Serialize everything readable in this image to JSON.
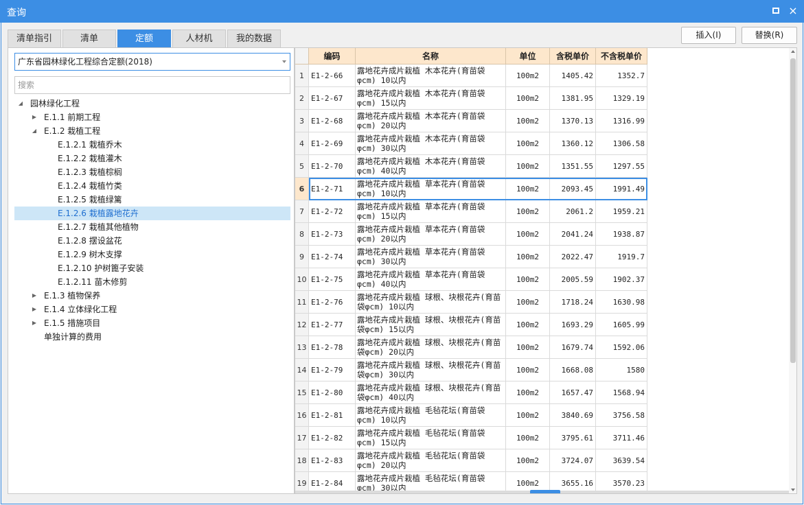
{
  "window": {
    "title": "查询",
    "maximize_icon": "maximize-icon",
    "close_glyph": "×"
  },
  "tabs": [
    {
      "label": "清单指引",
      "active": false
    },
    {
      "label": "清单",
      "active": false
    },
    {
      "label": "定额",
      "active": true
    },
    {
      "label": "人材机",
      "active": false
    },
    {
      "label": "我的数据",
      "active": false
    }
  ],
  "toolbar": {
    "insert_label": "插入(I)",
    "replace_label": "替换(R)"
  },
  "left": {
    "dropdown_value": "广东省园林绿化工程综合定额(2018)",
    "search_placeholder": "搜索",
    "tree": [
      {
        "label": "园林绿化工程",
        "level": 0,
        "toggle": "expanded"
      },
      {
        "label": "E.1.1 前期工程",
        "level": 1,
        "toggle": "collapsed"
      },
      {
        "label": "E.1.2 栽植工程",
        "level": 1,
        "toggle": "expanded"
      },
      {
        "label": "E.1.2.1 栽植乔木",
        "level": 2,
        "toggle": "none"
      },
      {
        "label": "E.1.2.2 栽植灌木",
        "level": 2,
        "toggle": "none"
      },
      {
        "label": "E.1.2.3 栽植棕榈",
        "level": 2,
        "toggle": "none"
      },
      {
        "label": "E.1.2.4 栽植竹类",
        "level": 2,
        "toggle": "none"
      },
      {
        "label": "E.1.2.5 栽植绿篱",
        "level": 2,
        "toggle": "none"
      },
      {
        "label": "E.1.2.6 栽植露地花卉",
        "level": 2,
        "toggle": "none",
        "selected": true
      },
      {
        "label": "E.1.2.7 栽植其他植物",
        "level": 2,
        "toggle": "none"
      },
      {
        "label": "E.1.2.8 摆设盆花",
        "level": 2,
        "toggle": "none"
      },
      {
        "label": "E.1.2.9 树木支撑",
        "level": 2,
        "toggle": "none"
      },
      {
        "label": "E.1.2.10 护树篦子安装",
        "level": 2,
        "toggle": "none"
      },
      {
        "label": "E.1.2.11 苗木修剪",
        "level": 2,
        "toggle": "none"
      },
      {
        "label": "E.1.3 植物保养",
        "level": 1,
        "toggle": "collapsed"
      },
      {
        "label": "E.1.4 立体绿化工程",
        "level": 1,
        "toggle": "collapsed"
      },
      {
        "label": "E.1.5 措施项目",
        "level": 1,
        "toggle": "collapsed"
      },
      {
        "label": "单独计算的费用",
        "level": 1,
        "toggle": "none"
      }
    ]
  },
  "grid": {
    "headers": {
      "code": "编码",
      "name": "名称",
      "unit": "单位",
      "price_tax": "含税单价",
      "price_notax": "不含税单价"
    },
    "selected_row": 6,
    "rows": [
      {
        "idx": "1",
        "code": "E1-2-66",
        "name": "露地花卉成片栽植 木本花卉(育苗袋φcm) 10以内",
        "unit": "100m2",
        "price_tax": "1405.42",
        "price_notax": "1352.7"
      },
      {
        "idx": "2",
        "code": "E1-2-67",
        "name": "露地花卉成片栽植 木本花卉(育苗袋φcm) 15以内",
        "unit": "100m2",
        "price_tax": "1381.95",
        "price_notax": "1329.19"
      },
      {
        "idx": "3",
        "code": "E1-2-68",
        "name": "露地花卉成片栽植 木本花卉(育苗袋φcm) 20以内",
        "unit": "100m2",
        "price_tax": "1370.13",
        "price_notax": "1316.99"
      },
      {
        "idx": "4",
        "code": "E1-2-69",
        "name": "露地花卉成片栽植 木本花卉(育苗袋φcm) 30以内",
        "unit": "100m2",
        "price_tax": "1360.12",
        "price_notax": "1306.58"
      },
      {
        "idx": "5",
        "code": "E1-2-70",
        "name": "露地花卉成片栽植 木本花卉(育苗袋φcm) 40以内",
        "unit": "100m2",
        "price_tax": "1351.55",
        "price_notax": "1297.55"
      },
      {
        "idx": "6",
        "code": "E1-2-71",
        "name": "露地花卉成片栽植 草本花卉(育苗袋φcm) 10以内",
        "unit": "100m2",
        "price_tax": "2093.45",
        "price_notax": "1991.49"
      },
      {
        "idx": "7",
        "code": "E1-2-72",
        "name": "露地花卉成片栽植 草本花卉(育苗袋φcm) 15以内",
        "unit": "100m2",
        "price_tax": "2061.2",
        "price_notax": "1959.21"
      },
      {
        "idx": "8",
        "code": "E1-2-73",
        "name": "露地花卉成片栽植 草本花卉(育苗袋φcm) 20以内",
        "unit": "100m2",
        "price_tax": "2041.24",
        "price_notax": "1938.87"
      },
      {
        "idx": "9",
        "code": "E1-2-74",
        "name": "露地花卉成片栽植 草本花卉(育苗袋φcm) 30以内",
        "unit": "100m2",
        "price_tax": "2022.47",
        "price_notax": "1919.7"
      },
      {
        "idx": "10",
        "code": "E1-2-75",
        "name": "露地花卉成片栽植 草本花卉(育苗袋φcm) 40以内",
        "unit": "100m2",
        "price_tax": "2005.59",
        "price_notax": "1902.37"
      },
      {
        "idx": "11",
        "code": "E1-2-76",
        "name": "露地花卉成片栽植 球根、块根花卉(育苗袋φcm) 10以内",
        "unit": "100m2",
        "price_tax": "1718.24",
        "price_notax": "1630.98"
      },
      {
        "idx": "12",
        "code": "E1-2-77",
        "name": "露地花卉成片栽植 球根、块根花卉(育苗袋φcm) 15以内",
        "unit": "100m2",
        "price_tax": "1693.29",
        "price_notax": "1605.99"
      },
      {
        "idx": "13",
        "code": "E1-2-78",
        "name": "露地花卉成片栽植 球根、块根花卉(育苗袋φcm) 20以内",
        "unit": "100m2",
        "price_tax": "1679.74",
        "price_notax": "1592.06"
      },
      {
        "idx": "14",
        "code": "E1-2-79",
        "name": "露地花卉成片栽植 球根、块根花卉(育苗袋φcm) 30以内",
        "unit": "100m2",
        "price_tax": "1668.08",
        "price_notax": "1580"
      },
      {
        "idx": "15",
        "code": "E1-2-80",
        "name": "露地花卉成片栽植 球根、块根花卉(育苗袋φcm) 40以内",
        "unit": "100m2",
        "price_tax": "1657.47",
        "price_notax": "1568.94"
      },
      {
        "idx": "16",
        "code": "E1-2-81",
        "name": "露地花卉成片栽植 毛毡花坛(育苗袋φcm) 10以内",
        "unit": "100m2",
        "price_tax": "3840.69",
        "price_notax": "3756.58"
      },
      {
        "idx": "17",
        "code": "E1-2-82",
        "name": "露地花卉成片栽植 毛毡花坛(育苗袋φcm) 15以内",
        "unit": "100m2",
        "price_tax": "3795.61",
        "price_notax": "3711.46"
      },
      {
        "idx": "18",
        "code": "E1-2-83",
        "name": "露地花卉成片栽植 毛毡花坛(育苗袋φcm) 20以内",
        "unit": "100m2",
        "price_tax": "3724.07",
        "price_notax": "3639.54"
      },
      {
        "idx": "19",
        "code": "E1-2-84",
        "name": "露地花卉成片栽植 毛毡花坛(育苗袋φcm) 30以内",
        "unit": "100m2",
        "price_tax": "3655.16",
        "price_notax": "3570.23"
      }
    ]
  }
}
